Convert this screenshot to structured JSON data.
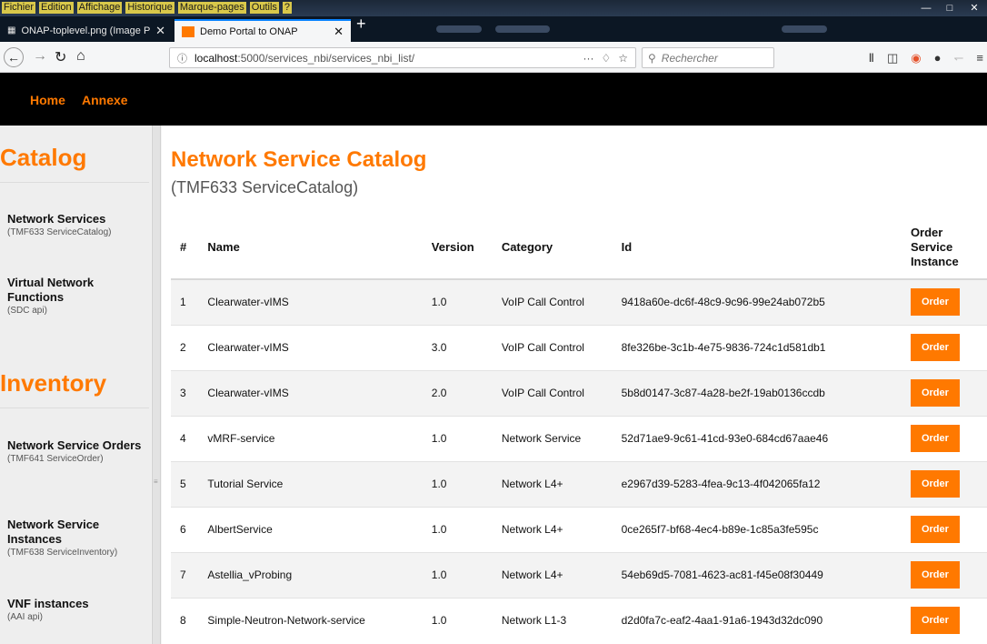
{
  "browser": {
    "menu": [
      "Fichier",
      "Edition",
      "Affichage",
      "Historique",
      "Marque-pages",
      "Outils",
      "?"
    ],
    "tabs": [
      {
        "label": "ONAP-toplevel.png (Image PN"
      },
      {
        "label": "Demo Portal to ONAP"
      }
    ],
    "url_host": "localhost",
    "url_path": ":5000/services_nbi/services_nbi_list/",
    "search_placeholder": "Rechercher",
    "url_actions": "···"
  },
  "nav": {
    "home": "Home",
    "annexe": "Annexe"
  },
  "sidebar": {
    "catalog_heading": "Catalog",
    "inventory_heading": "Inventory",
    "items": [
      {
        "title": "Network Services",
        "subtitle": "(TMF633 ServiceCatalog)"
      },
      {
        "title": "Virtual Network Functions",
        "subtitle": "(SDC api)"
      },
      {
        "title": "Network Service Orders",
        "subtitle": "(TMF641 ServiceOrder)"
      },
      {
        "title": "Network Service Instances",
        "subtitle": "(TMF638 ServiceInventory)"
      },
      {
        "title": "VNF instances",
        "subtitle": "(AAI api)"
      }
    ]
  },
  "main": {
    "title": "Network Service Catalog",
    "subtitle": "(TMF633 ServiceCatalog)",
    "columns": [
      "#",
      "Name",
      "Version",
      "Category",
      "Id",
      "Order Service Instance"
    ],
    "order_label": "Order",
    "rows": [
      {
        "n": "1",
        "name": "Clearwater-vIMS",
        "version": "1.0",
        "category": "VoIP Call Control",
        "id": "9418a60e-dc6f-48c9-9c96-99e24ab072b5"
      },
      {
        "n": "2",
        "name": "Clearwater-vIMS",
        "version": "3.0",
        "category": "VoIP Call Control",
        "id": "8fe326be-3c1b-4e75-9836-724c1d581db1"
      },
      {
        "n": "3",
        "name": "Clearwater-vIMS",
        "version": "2.0",
        "category": "VoIP Call Control",
        "id": "5b8d0147-3c87-4a28-be2f-19ab0136ccdb"
      },
      {
        "n": "4",
        "name": "vMRF-service",
        "version": "1.0",
        "category": "Network Service",
        "id": "52d71ae9-9c61-41cd-93e0-684cd67aae46"
      },
      {
        "n": "5",
        "name": "Tutorial Service",
        "version": "1.0",
        "category": "Network L4+",
        "id": "e2967d39-5283-4fea-9c13-4f042065fa12"
      },
      {
        "n": "6",
        "name": "AlbertService",
        "version": "1.0",
        "category": "Network L4+",
        "id": "0ce265f7-bf68-4ec4-b89e-1c85a3fe595c"
      },
      {
        "n": "7",
        "name": "Astellia_vProbing",
        "version": "1.0",
        "category": "Network L4+",
        "id": "54eb69d5-7081-4623-ac81-f45e08f30449"
      },
      {
        "n": "8",
        "name": "Simple-Neutron-Network-service",
        "version": "1.0",
        "category": "Network L1-3",
        "id": "d2d0fa7c-eaf2-4aa1-91a6-1943d32dc090"
      }
    ]
  },
  "colors": {
    "accent": "#ff7900",
    "navbar": "#000000"
  }
}
